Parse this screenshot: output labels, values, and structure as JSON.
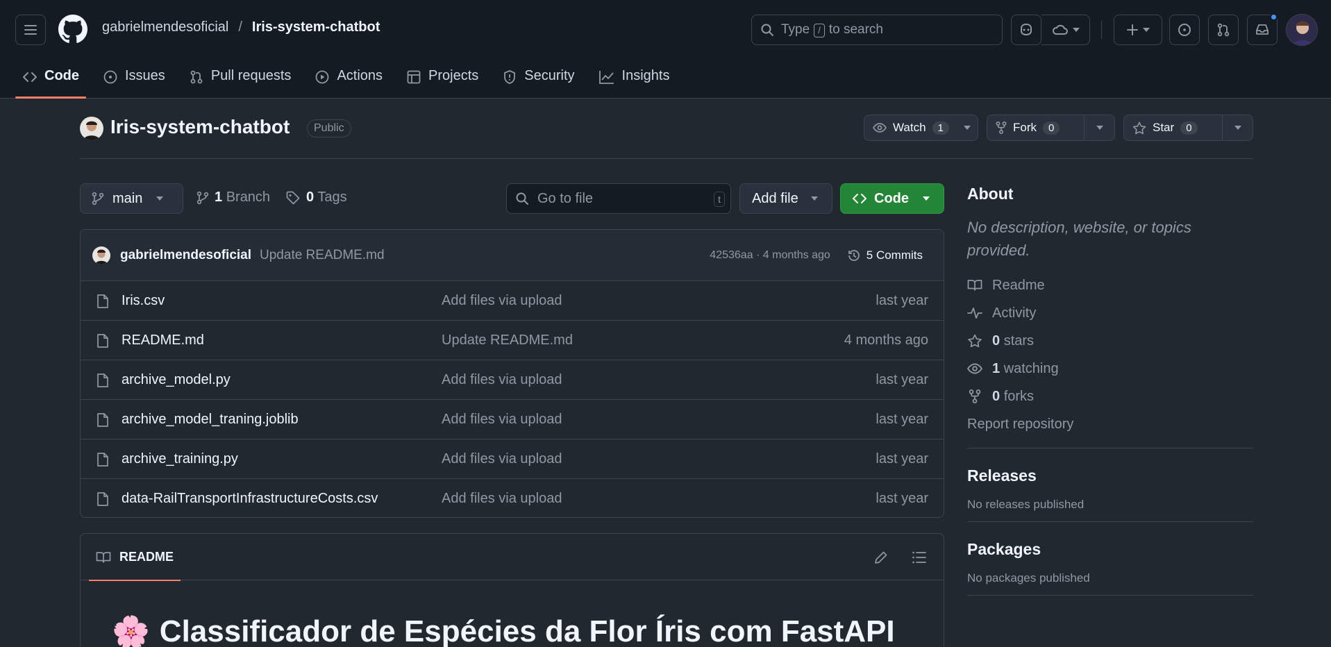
{
  "header": {
    "owner": "gabrielmendesoficial",
    "separator": "/",
    "repo": "Iris-system-chatbot",
    "search": {
      "before": "Type",
      "key": "/",
      "after": "to search"
    }
  },
  "tabs": [
    {
      "label": "Code",
      "icon": "code-icon",
      "active": true
    },
    {
      "label": "Issues",
      "icon": "issue-icon"
    },
    {
      "label": "Pull requests",
      "icon": "pull-request-icon"
    },
    {
      "label": "Actions",
      "icon": "play-icon"
    },
    {
      "label": "Projects",
      "icon": "table-icon"
    },
    {
      "label": "Security",
      "icon": "shield-icon"
    },
    {
      "label": "Insights",
      "icon": "graph-icon"
    }
  ],
  "repo_header": {
    "title": "Iris-system-chatbot",
    "visibility": "Public",
    "watch": {
      "label": "Watch",
      "count": "1"
    },
    "fork": {
      "label": "Fork",
      "count": "0"
    },
    "star": {
      "label": "Star",
      "count": "0"
    }
  },
  "toolbar": {
    "branch": "main",
    "branch_count": "1",
    "branch_label": "Branch",
    "tag_count": "0",
    "tag_label": "Tags",
    "goto_placeholder": "Go to file",
    "goto_key": "t",
    "add_file": "Add file",
    "code": "Code"
  },
  "commit": {
    "author": "gabrielmendesoficial",
    "message": "Update README.md",
    "hash_time": "42536aa · 4 months ago",
    "commits_label": "5 Commits"
  },
  "files": [
    {
      "name": "Iris.csv",
      "message": "Add files via upload",
      "date": "last year"
    },
    {
      "name": "README.md",
      "message": "Update README.md",
      "date": "4 months ago"
    },
    {
      "name": "archive_model.py",
      "message": "Add files via upload",
      "date": "last year"
    },
    {
      "name": "archive_model_traning.joblib",
      "message": "Add files via upload",
      "date": "last year"
    },
    {
      "name": "archive_training.py",
      "message": "Add files via upload",
      "date": "last year"
    },
    {
      "name": "data-RailTransportInfrastructureCosts.csv",
      "message": "Add files via upload",
      "date": "last year"
    }
  ],
  "readme": {
    "tab": "README",
    "emoji": "🌸",
    "heading": "Classificador de Espécies da Flor Íris com FastAPI"
  },
  "sidebar": {
    "about_title": "About",
    "about_desc": "No description, website, or topics provided.",
    "readme": "Readme",
    "activity": "Activity",
    "stars_count": "0",
    "stars_label": "stars",
    "watching_count": "1",
    "watching_label": "watching",
    "forks_count": "0",
    "forks_label": "forks",
    "report": "Report repository",
    "releases_title": "Releases",
    "releases_desc": "No releases published",
    "packages_title": "Packages",
    "packages_desc": "No packages published"
  },
  "colors": {
    "background": "#212830",
    "header": "#151b23",
    "border": "#3d444d",
    "accent_tab": "#f78166",
    "code_button": "#238636",
    "notification": "#4493f8"
  }
}
